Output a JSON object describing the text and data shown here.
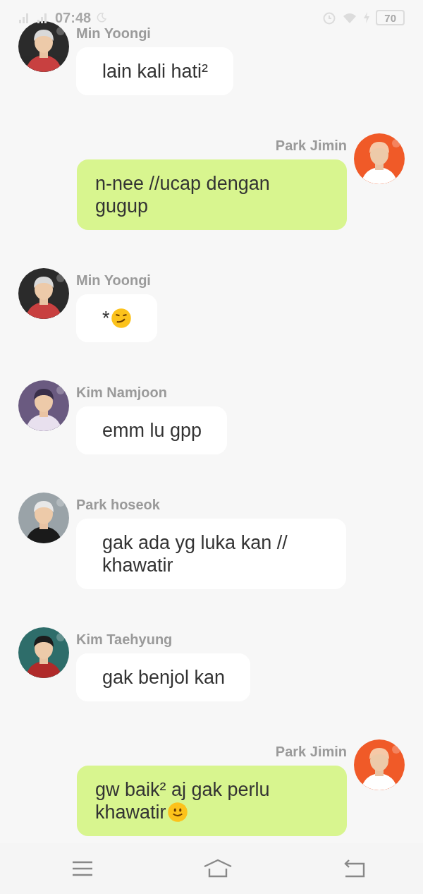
{
  "status_bar": {
    "time": "07:48",
    "battery": "70"
  },
  "messages": [
    {
      "sender": "Min Yoongi",
      "outgoing": false,
      "kind": "plain",
      "text": "lain kali hati²"
    },
    {
      "sender": "Park Jimin",
      "outgoing": true,
      "kind": "plain",
      "text": "n-nee //ucap dengan gugup"
    },
    {
      "sender": "Min Yoongi",
      "outgoing": false,
      "kind": "smirk",
      "text": "*"
    },
    {
      "sender": "Kim Namjoon",
      "outgoing": false,
      "kind": "plain",
      "text": "emm lu gpp"
    },
    {
      "sender": "Park hoseok",
      "outgoing": false,
      "kind": "plain",
      "text": "gak ada yg luka kan // khawatir"
    },
    {
      "sender": "Kim Taehyung",
      "outgoing": false,
      "kind": "plain",
      "text": "gak benjol kan"
    },
    {
      "sender": "Park Jimin",
      "outgoing": true,
      "kind": "smile",
      "text": "gw baik² aj gak perlu khawatir"
    }
  ]
}
